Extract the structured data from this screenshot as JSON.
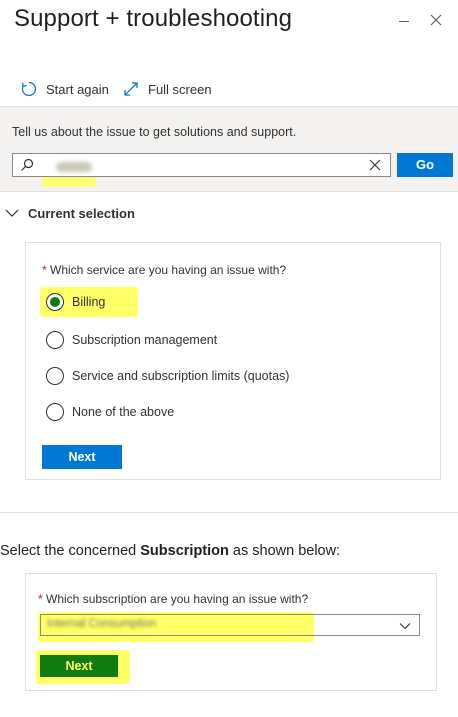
{
  "header": {
    "title": "Support + troubleshooting"
  },
  "toolbar": {
    "start_again_label": "Start again",
    "full_screen_label": "Full screen"
  },
  "search": {
    "prompt": "Tell us about the issue to get solutions and support.",
    "value": "",
    "go_label": "Go"
  },
  "current_selection": {
    "header_label": "Current selection",
    "question": "Which service are you having an issue with?",
    "required_marker": "*",
    "options": [
      {
        "label": "Billing",
        "selected": true
      },
      {
        "label": "Subscription management",
        "selected": false
      },
      {
        "label": "Service and subscription limits (quotas)",
        "selected": false
      },
      {
        "label": "None of the above",
        "selected": false
      }
    ],
    "next_label": "Next"
  },
  "subscription": {
    "instruction_prefix": "Select the concerned ",
    "instruction_bold": "Subscription",
    "instruction_suffix": " as shown below:",
    "question": "Which subscription are you having an issue with?",
    "required_marker": "*",
    "selected_value": "Internal Consumption",
    "next_label": "Next"
  },
  "colors": {
    "accent_blue": "#0078d4",
    "success_green": "#107c10",
    "highlight_yellow": "#ffff66",
    "required_red": "#a4262c"
  }
}
